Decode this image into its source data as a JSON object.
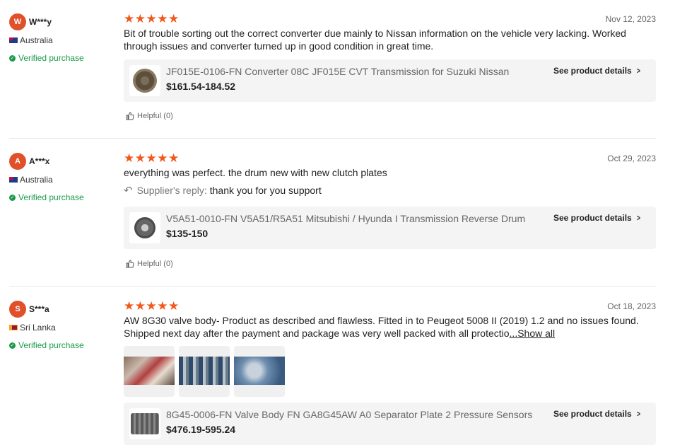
{
  "reviews": [
    {
      "initial": "W",
      "name": "W***y",
      "country": "Australia",
      "verified": "Verified purchase",
      "rating": 5,
      "date": "Nov 12, 2023",
      "text": "Bit of trouble sorting out the correct converter due mainly to Nissan information on the vehicle very lacking. Worked through issues and converter turned up in good condition in great time.",
      "product_title": "JF015E-0106-FN Converter 08C JF015E CVT Transmission for Suzuki Nissan",
      "product_price": "$161.54-184.52",
      "see_details": "See product details",
      "helpful": "Helpful (0)"
    },
    {
      "initial": "A",
      "name": "A***x",
      "country": "Australia",
      "verified": "Verified purchase",
      "rating": 5,
      "date": "Oct 29, 2023",
      "text": "everything was perfect. the drum new with new clutch plates",
      "reply_label": "Supplier's reply:",
      "reply_text": "thank you for you support",
      "product_title": "V5A51-0010-FN V5A51/R5A51 Mitsubishi / Hyunda I Transmission Reverse Drum",
      "product_price": "$135-150",
      "see_details": "See product details",
      "helpful": "Helpful (0)"
    },
    {
      "initial": "S",
      "name": "S***a",
      "country": "Sri Lanka",
      "verified": "Verified purchase",
      "rating": 5,
      "date": "Oct 18, 2023",
      "text": "AW 8G30 valve body- Product as described and flawless. Fitted in to Peugeot 5008 II (2019) 1.2 and no issues found. Shipped next day after the payment and package was very well packed with all protectio",
      "show_all": "...Show all",
      "product_title": "8G45-0006-FN Valve Body FN GA8G45AW A0 Separator Plate 2 Pressure Sensors",
      "product_price": "$476.19-595.24",
      "see_details": "See product details"
    }
  ],
  "colors": {
    "star": "#f0581c",
    "avatar": "#e0502a",
    "verified": "#1a9a4a"
  }
}
